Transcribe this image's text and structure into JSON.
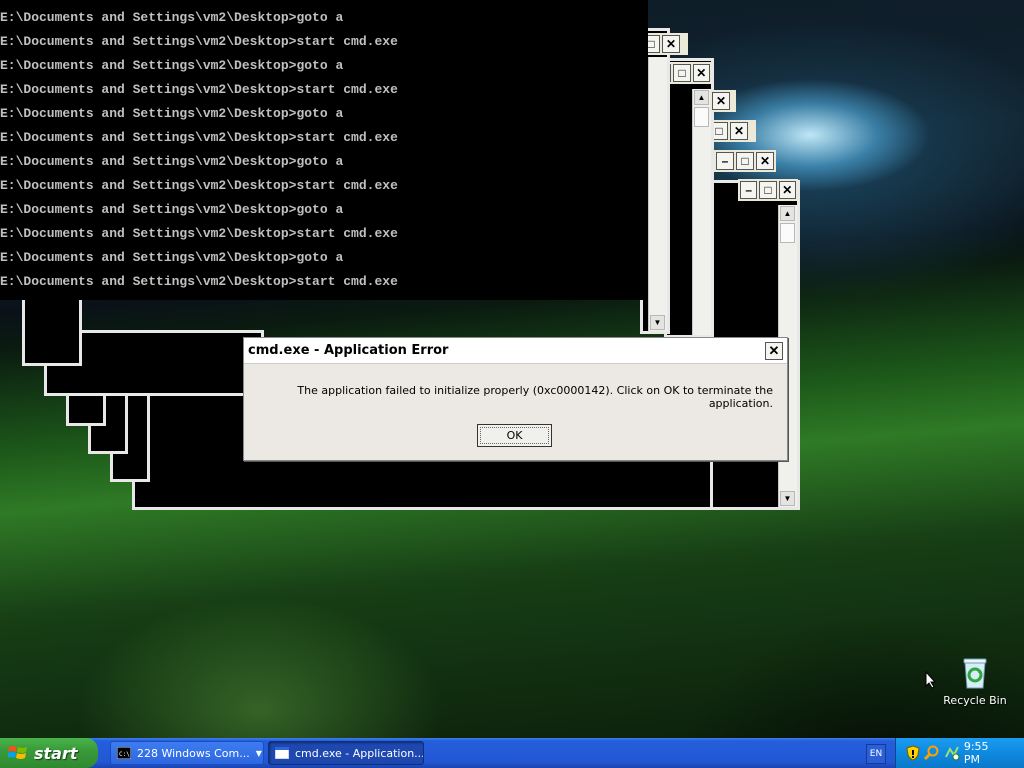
{
  "console": {
    "lines": [
      "E:\\Documents and Settings\\vm2\\Desktop>goto a",
      "E:\\Documents and Settings\\vm2\\Desktop>start cmd.exe",
      "E:\\Documents and Settings\\vm2\\Desktop>goto a",
      "E:\\Documents and Settings\\vm2\\Desktop>start cmd.exe",
      "E:\\Documents and Settings\\vm2\\Desktop>goto a",
      "E:\\Documents and Settings\\vm2\\Desktop>start cmd.exe",
      "E:\\Documents and Settings\\vm2\\Desktop>goto a",
      "E:\\Documents and Settings\\vm2\\Desktop>start cmd.exe",
      "E:\\Documents and Settings\\vm2\\Desktop>goto a",
      "E:\\Documents and Settings\\vm2\\Desktop>start cmd.exe",
      "E:\\Documents and Settings\\vm2\\Desktop>goto a",
      "E:\\Documents and Settings\\vm2\\Desktop>start cmd.exe"
    ]
  },
  "dialog": {
    "title": "cmd.exe - Application Error",
    "message": "The application failed to initialize properly (0xc0000142). Click on OK to terminate the application.",
    "ok_label": "OK",
    "close_glyph": "✕"
  },
  "desktop": {
    "recycle_bin_label": "Recycle Bin"
  },
  "taskbar": {
    "start_label": "start",
    "tasks": [
      {
        "label": "228 Windows Com...",
        "icon": "cmd-icon",
        "active": false
      },
      {
        "label": "cmd.exe - Application...",
        "icon": "window-icon",
        "active": true
      }
    ],
    "language": "EN",
    "clock": "9:55 PM"
  },
  "colors": {
    "taskbar_blue": "#245edb",
    "start_green": "#3a9a3a",
    "tray_blue": "#0e8ae0",
    "console_text": "#c0c0c0"
  }
}
